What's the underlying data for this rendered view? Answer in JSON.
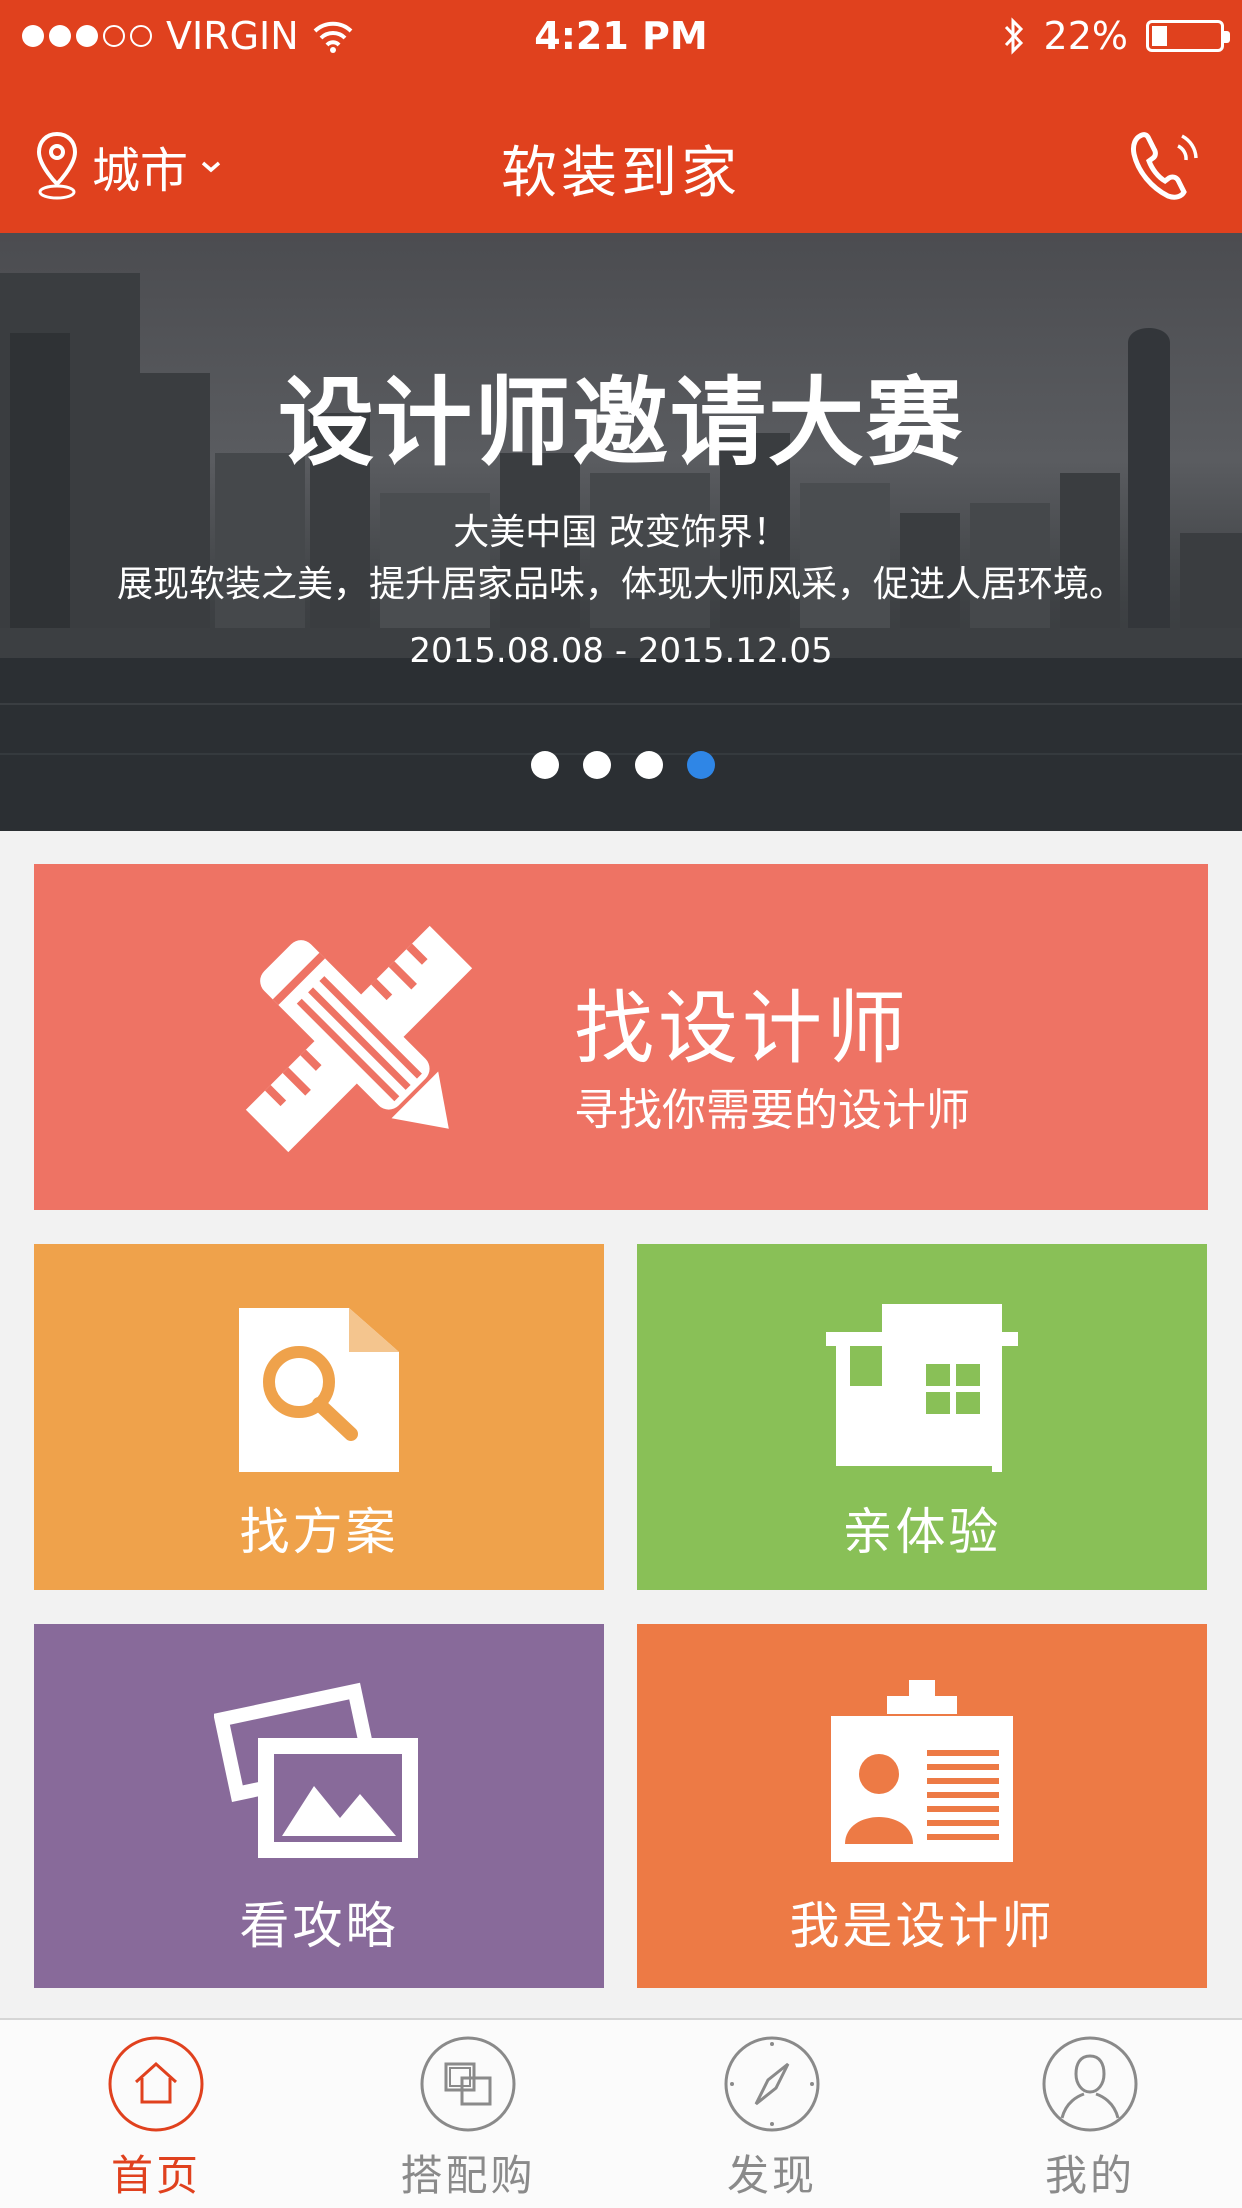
{
  "status_bar": {
    "carrier": "VIRGIN",
    "time": "4:21 PM",
    "battery_text": "22%",
    "battery_level": 0.22,
    "signal_bars_filled": 3,
    "signal_bars_total": 5
  },
  "header": {
    "city_label": "城市",
    "title": "软装到家"
  },
  "banner": {
    "headline": "设计师邀请大赛",
    "subtitle_1": "大美中国 改变饰界！",
    "subtitle_2": "展现软装之美，提升居家品味，体现大师风采，促进人居环境。",
    "dates": "2015.08.08  -  2015.12.05",
    "pages_total": 4,
    "active_page": 4
  },
  "tiles": {
    "find_designer": {
      "title": "找设计师",
      "subtitle": "寻找你需要的设计师",
      "color": "#ee7364"
    },
    "find_scheme": {
      "label": "找方案",
      "color": "#efa24b"
    },
    "experience": {
      "label": "亲体验",
      "color": "#89c057"
    },
    "guide": {
      "label": "看攻略",
      "color": "#886a9a"
    },
    "i_am_designer": {
      "label": "我是设计师",
      "color": "#ed7a45"
    }
  },
  "tabbar": {
    "home": "首页",
    "match_buy": "搭配购",
    "discover": "发现",
    "mine": "我的",
    "active_color": "#e0411e",
    "inactive_color": "#8a8a8a"
  },
  "colors": {
    "brand": "#e0411e",
    "pager_active": "#2f86e6"
  }
}
